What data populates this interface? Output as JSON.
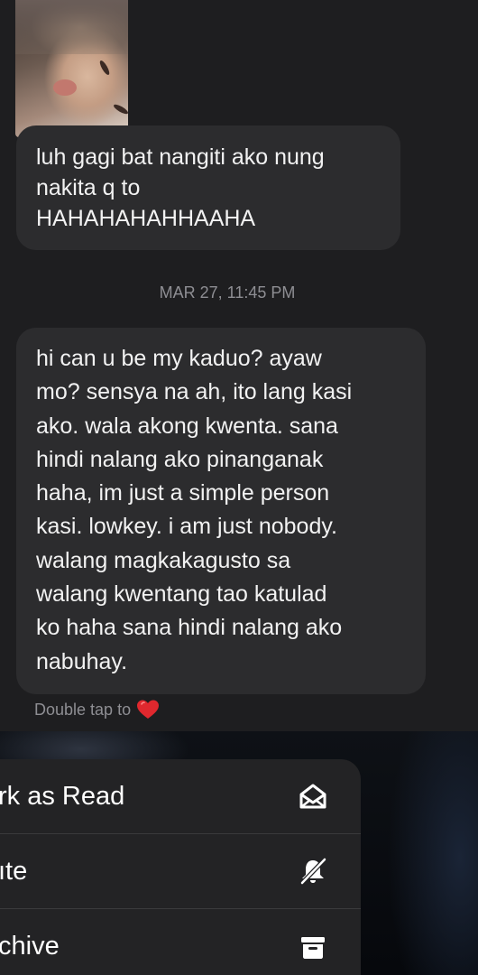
{
  "chat": {
    "message1": {
      "lines": [
        "luh gagi bat nangiti ako nung",
        "nakita q to",
        "HAHAHAHAHHAAHA"
      ]
    },
    "timestamp": "MAR 27, 11:45 PM",
    "message2": {
      "lines": [
        "hi can u be my kaduo? ayaw",
        "mo? sensya na ah, ito lang kasi",
        "ako. wala akong kwenta. sana",
        "hindi nalang ako pinanganak",
        "haha, im just a simple person",
        "kasi. lowkey. i am just nobody.",
        "walang magkakagusto sa",
        "walang kwentang tao katulad",
        "ko haha sana hindi nalang ako",
        "nabuhay."
      ]
    },
    "hint": "Double tap to",
    "hint_icon": "heart-icon",
    "heart_color": "#e0282e"
  },
  "context_menu": {
    "items": [
      {
        "label": "rk as Read",
        "icon": "envelope-open-icon"
      },
      {
        "label": "ıte",
        "icon": "bell-slash-icon"
      },
      {
        "label": "chive",
        "icon": "archive-box-icon"
      }
    ]
  },
  "colors": {
    "background": "#1e1e20",
    "bubble": "#2c2c2e",
    "secondary_text": "#8e8e93"
  }
}
